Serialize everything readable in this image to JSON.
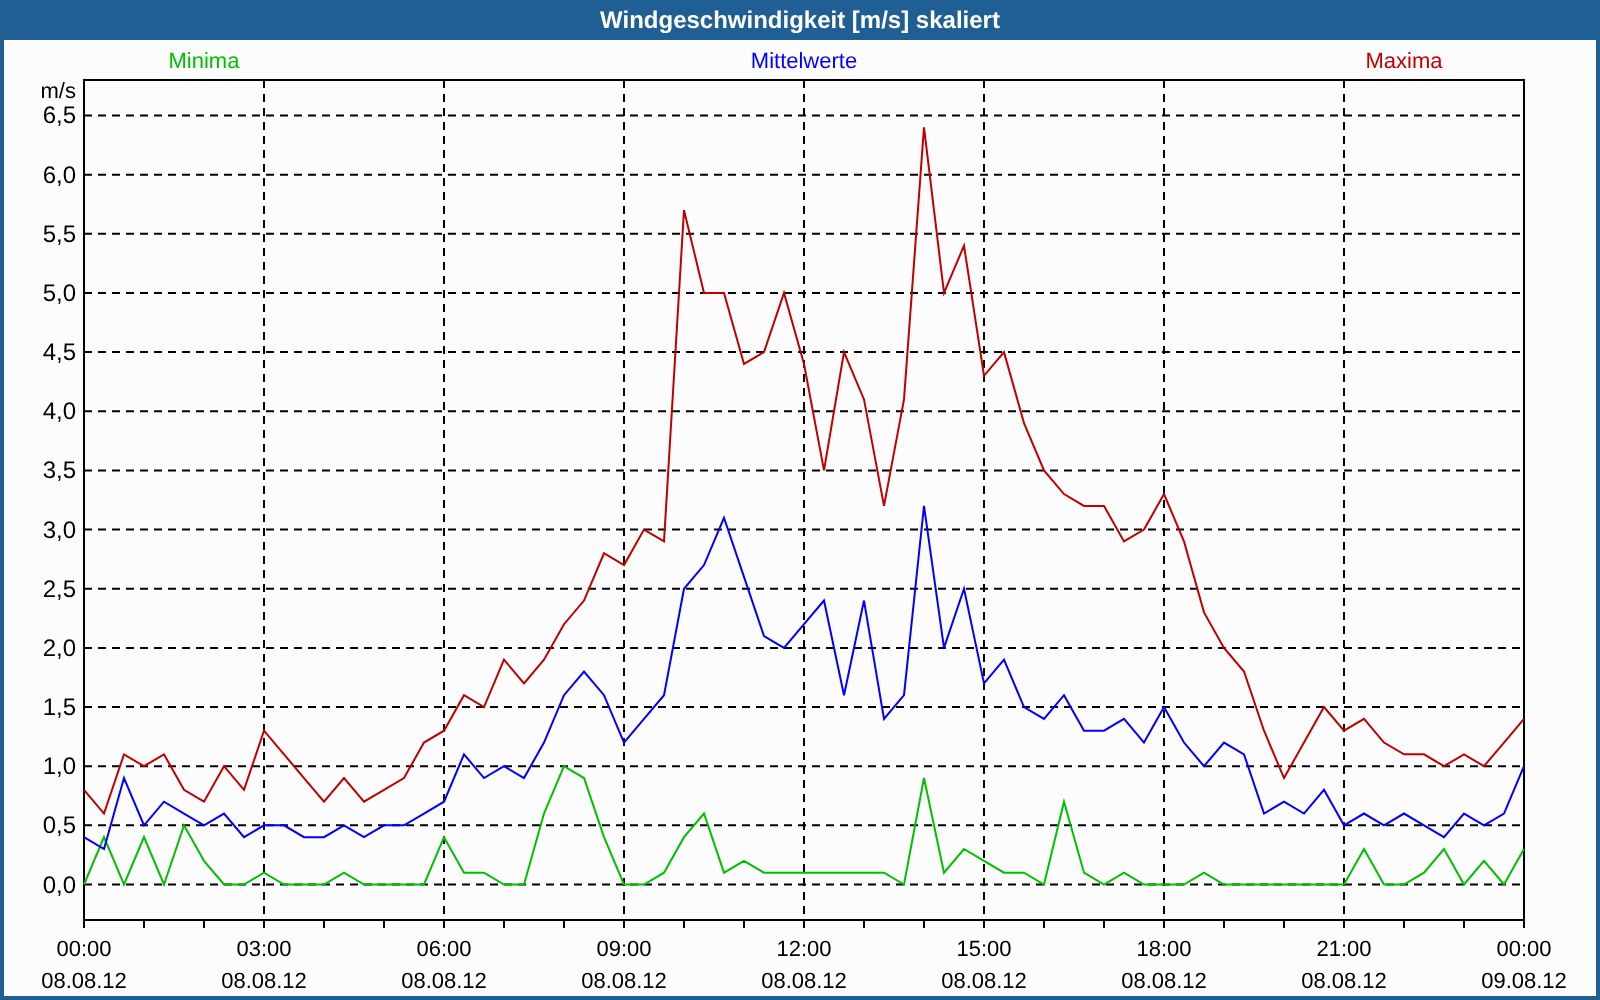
{
  "window": {
    "title": "Windgeschwindigkeit [m/s] skaliert"
  },
  "chart": {
    "chart_data": {
      "type": "line",
      "ylabel": "m/s",
      "categories": [
        "00:00 08.08.12",
        null,
        null,
        null,
        null,
        null,
        null,
        null,
        null,
        "03:00 08.08.12",
        null,
        null,
        null,
        null,
        null,
        null,
        null,
        null,
        "06:00 08.08.12",
        null,
        null,
        null,
        null,
        null,
        null,
        null,
        null,
        "09:00 08.08.12",
        null,
        null,
        null,
        null,
        null,
        null,
        null,
        null,
        "12:00 08.08.12",
        null,
        null,
        null,
        null,
        null,
        null,
        null,
        null,
        "15:00 08.08.12",
        null,
        null,
        null,
        null,
        null,
        null,
        null,
        null,
        "18:00 08.08.12",
        null,
        null,
        null,
        null,
        null,
        null,
        null,
        null,
        "21:00 08.08.12",
        null,
        null,
        null,
        null,
        null,
        null,
        null,
        null,
        "00:00 09.08.12"
      ],
      "series": [
        {
          "name": "Minima",
          "color": "#00c000",
          "values": [
            0,
            0.4,
            0,
            0.4,
            0,
            0.5,
            0.2,
            0,
            0,
            0.1,
            0,
            0,
            0,
            0.1,
            0,
            0,
            0,
            0,
            0.4,
            0.1,
            0.1,
            0,
            0,
            0.6,
            1.0,
            0.9,
            0.4,
            0,
            0,
            0.1,
            0.4,
            0.6,
            0.1,
            0.2,
            0.1,
            0.1,
            0.1,
            0.1,
            0.1,
            0.1,
            0.1,
            0,
            0.9,
            0.1,
            0.3,
            0.2,
            0.1,
            0.1,
            0,
            0.7,
            0.1,
            0,
            0.1,
            0,
            0,
            0,
            0.1,
            0,
            0,
            0,
            0,
            0,
            0,
            0,
            0.3,
            0,
            0,
            0.1,
            0.3,
            0,
            0.2,
            0,
            0.3
          ]
        },
        {
          "name": "Mittelwerte",
          "color": "#0000ff",
          "values": [
            0.4,
            0.3,
            0.9,
            0.5,
            0.7,
            0.6,
            0.5,
            0.6,
            0.4,
            0.5,
            0.5,
            0.4,
            0.4,
            0.5,
            0.4,
            0.5,
            0.5,
            0.6,
            0.7,
            1.1,
            0.9,
            1.0,
            0.9,
            1.2,
            1.6,
            1.8,
            1.6,
            1.2,
            1.4,
            1.6,
            2.5,
            2.7,
            3.1,
            2.6,
            2.1,
            2.0,
            2.2,
            2.4,
            1.6,
            2.4,
            1.4,
            1.6,
            3.2,
            2.0,
            2.5,
            1.7,
            1.9,
            1.5,
            1.4,
            1.6,
            1.3,
            1.3,
            1.4,
            1.2,
            1.5,
            1.2,
            1.0,
            1.2,
            1.1,
            0.6,
            0.7,
            0.6,
            0.8,
            0.5,
            0.6,
            0.5,
            0.6,
            0.5,
            0.4,
            0.6,
            0.5,
            0.6,
            1.0
          ]
        },
        {
          "name": "Maxima",
          "color": "#c00000",
          "values": [
            0.8,
            0.6,
            1.1,
            1.0,
            1.1,
            0.8,
            0.7,
            1.0,
            0.8,
            1.3,
            1.1,
            0.9,
            0.7,
            0.9,
            0.7,
            0.8,
            0.9,
            1.2,
            1.3,
            1.6,
            1.5,
            1.9,
            1.7,
            1.9,
            2.2,
            2.4,
            2.8,
            2.7,
            3.0,
            2.9,
            5.7,
            5.0,
            5.0,
            4.4,
            4.5,
            5.0,
            4.4,
            3.5,
            4.5,
            4.1,
            3.2,
            4.1,
            6.4,
            5.0,
            5.4,
            4.3,
            4.5,
            3.9,
            3.5,
            3.3,
            3.2,
            3.2,
            2.9,
            3.0,
            3.3,
            2.9,
            2.3,
            2.0,
            1.8,
            1.3,
            0.9,
            1.2,
            1.5,
            1.3,
            1.4,
            1.2,
            1.1,
            1.1,
            1.0,
            1.1,
            1.0,
            1.2,
            1.4
          ]
        }
      ],
      "ylim": [
        -0.3,
        6.8
      ],
      "grid": true,
      "yticks": [
        {
          "value": 0,
          "label": "0,0"
        },
        {
          "value": 0.5,
          "label": "0,5"
        },
        {
          "value": 1,
          "label": "1,0"
        },
        {
          "value": 1.5,
          "label": "1,5"
        },
        {
          "value": 2,
          "label": "2,0"
        },
        {
          "value": 2.5,
          "label": "2,5"
        },
        {
          "value": 3,
          "label": "3,0"
        },
        {
          "value": 3.5,
          "label": "3,5"
        },
        {
          "value": 4,
          "label": "4,0"
        },
        {
          "value": 4.5,
          "label": "4,5"
        },
        {
          "value": 5,
          "label": "5,0"
        },
        {
          "value": 5.5,
          "label": "5,5"
        },
        {
          "value": 6,
          "label": "6,0"
        },
        {
          "value": 6.5,
          "label": "6,5"
        }
      ]
    }
  }
}
